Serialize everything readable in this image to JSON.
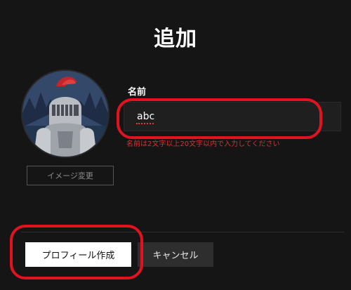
{
  "title": "追加",
  "avatar": {
    "icon": "knight-avatar-icon"
  },
  "change_image_label": "イメージ変更",
  "name": {
    "label": "名前",
    "value": "abc",
    "error": "名前は2文字以上20文字以内で入力してください"
  },
  "buttons": {
    "create_label": "プロフィール作成",
    "cancel_label": "キャンセル"
  },
  "colors": {
    "background": "#151515",
    "highlight": "#e1131f",
    "error": "#d63232"
  }
}
